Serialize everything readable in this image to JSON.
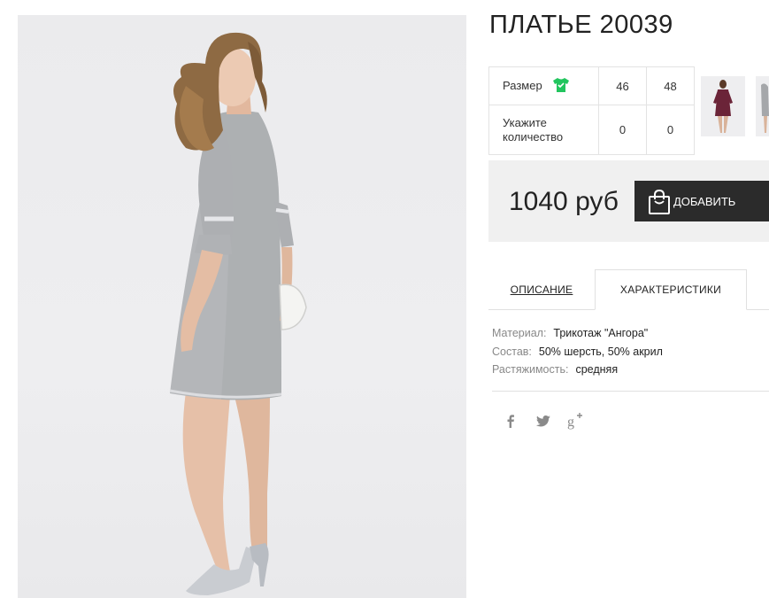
{
  "product": {
    "title": "ПЛАТЬЕ 20039",
    "price": "1040 руб",
    "add_button_label": "ДОБАВИТЬ"
  },
  "size_table": {
    "size_label": "Размер",
    "size_icon": "tshirt-icon",
    "quantity_label": "Укажите количество",
    "sizes": [
      {
        "size": "46",
        "quantity": "0"
      },
      {
        "size": "48",
        "quantity": "0"
      }
    ]
  },
  "tabs": [
    {
      "label": "ОПИСАНИЕ",
      "active": false
    },
    {
      "label": "ХАРАКТЕРИСТИКИ",
      "active": true
    }
  ],
  "characteristics": [
    {
      "key": "Материал:",
      "value": "Трикотаж \"Ангора\""
    },
    {
      "key": "Состав:",
      "value": "50% шерсть, 50% акрил"
    },
    {
      "key": "Растяжимость:",
      "value": "средняя"
    }
  ],
  "social": [
    "facebook-icon",
    "twitter-icon",
    "google-plus-icon"
  ],
  "colors": {
    "button_bg": "#2b2b2b",
    "price_bg": "#f0f0f0",
    "size_icon": "#22c55e",
    "thumbnail_dress": "#6b2438"
  }
}
